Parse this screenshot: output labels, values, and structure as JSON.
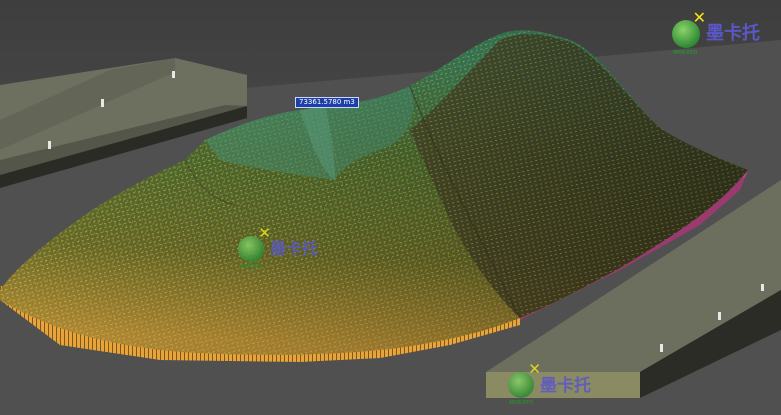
{
  "viewer": {
    "volume_label": "73361.5780 m3",
    "background_color": "#4c4c4c"
  },
  "watermarks": [
    {
      "brand": "墨卡托",
      "sub": "MOKATO"
    },
    {
      "brand": "墨卡托",
      "sub": "MOKATO"
    },
    {
      "brand": "墨卡托",
      "sub": "MOKATO"
    }
  ],
  "colors": {
    "pile_top": "#3d7d5a",
    "pile_mid": "#6e7a2a",
    "pile_base": "#b9862d",
    "skirt": "#e9a63a",
    "side_magenta": "#a3326b",
    "platform_top": "#6d6f5f",
    "platform_side": "#2c2d27",
    "label_bg": "#1f3fa8"
  }
}
